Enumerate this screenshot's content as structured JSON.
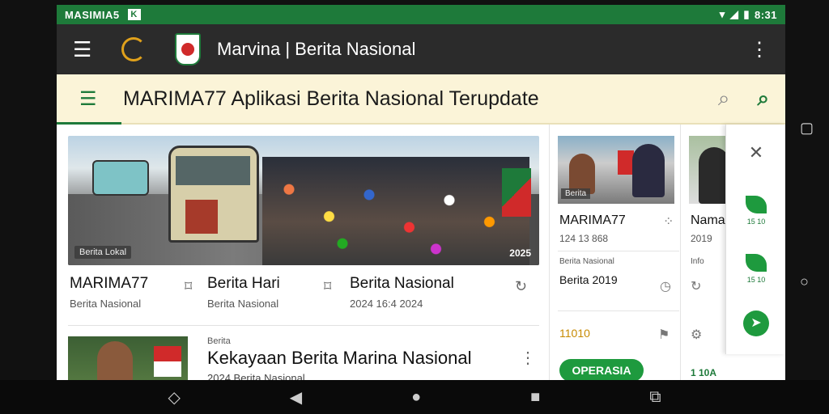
{
  "status_bar": {
    "carrier": "MASIMIA5",
    "box_glyph": "K",
    "icons": [
      "wifi-icon",
      "signal-icon",
      "battery-icon"
    ],
    "time": "8:31"
  },
  "app_bar": {
    "title": "Marvina | Berita Nasional"
  },
  "search_header": {
    "title": "MARIMA77 Aplikasi Berita Nasional Terupdate"
  },
  "hero": {
    "tag": "Berita Lokal",
    "badge": "2025"
  },
  "hero_items": [
    {
      "title": "MARIMA77",
      "subtitle": "Berita Nasional"
    },
    {
      "title": "Berita Hari",
      "subtitle": "Berita Nasional"
    },
    {
      "title": "Berita Nasional",
      "subtitle": "2024 16:4 2024"
    }
  ],
  "card2": {
    "category": "Berita",
    "title": "Kekayaan Berita Marina Nasional",
    "meta": "2024 Berita Nasional"
  },
  "side_a": {
    "thumb_tag": "Berita",
    "title": "MARIMA77",
    "sub": "124 13 868",
    "row2_label": "Berita Nasional",
    "row2_value": "Berita 2019",
    "row3_value": "11010",
    "button": "OPERASIA"
  },
  "side_b": {
    "title": "Nama",
    "sub": "2019",
    "row2_label": "Info",
    "row3_label": "1 10A"
  },
  "rail": [
    {
      "label": "15 10"
    },
    {
      "label": "15 10"
    }
  ]
}
